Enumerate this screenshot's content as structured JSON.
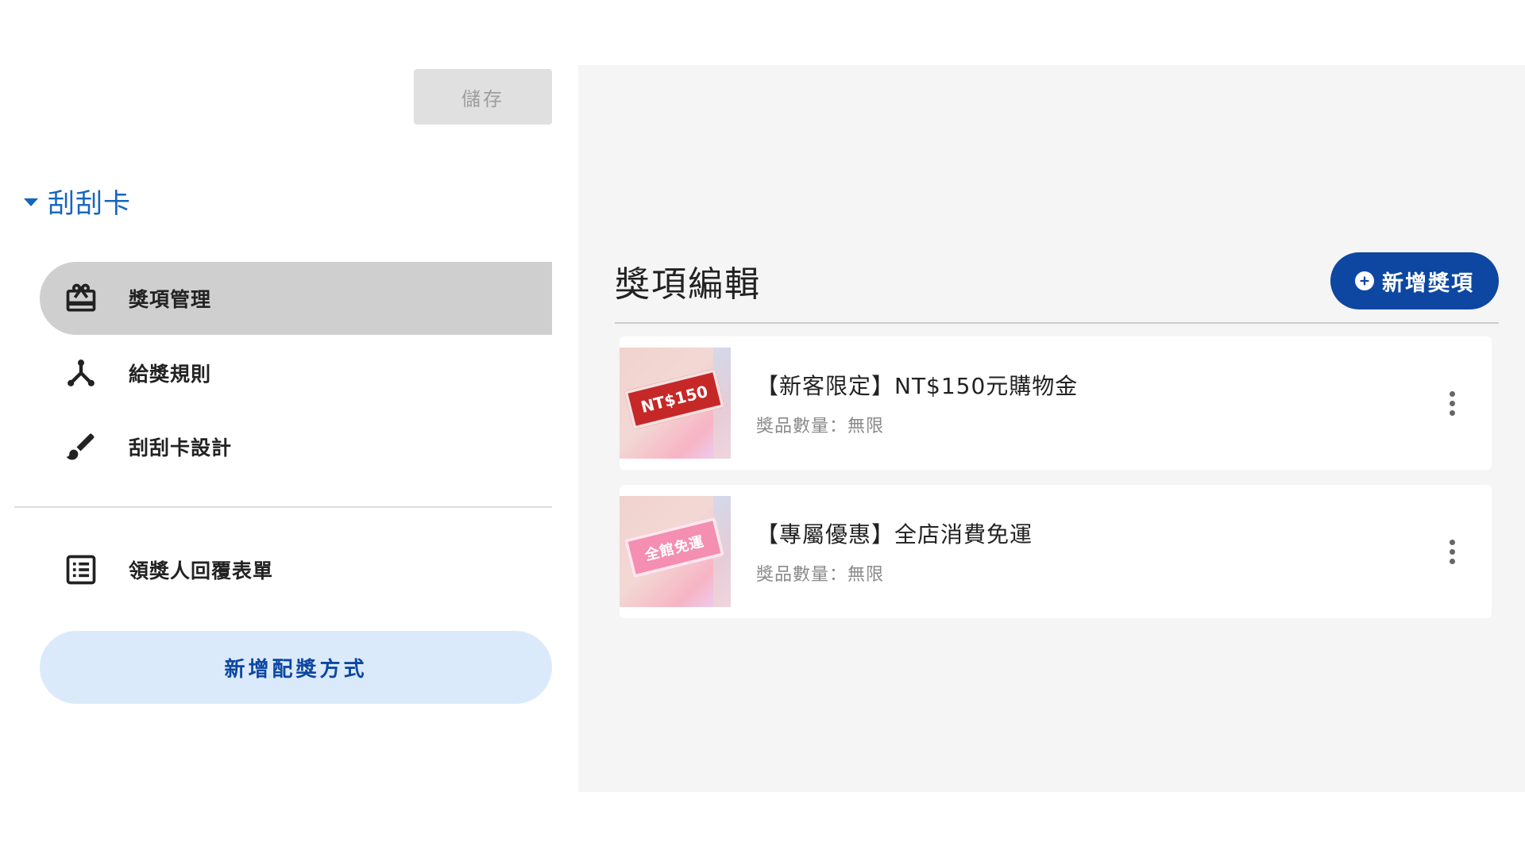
{
  "toolbar": {
    "save_label": "儲存"
  },
  "sidebar": {
    "section_title": "刮刮卡",
    "items": [
      {
        "label": "獎項管理",
        "icon": "gift-card-icon",
        "active": true
      },
      {
        "label": "給獎規則",
        "icon": "rule-split-icon",
        "active": false
      },
      {
        "label": "刮刮卡設計",
        "icon": "paint-brush-icon",
        "active": false
      },
      {
        "label": "領獎人回覆表單",
        "icon": "list-form-icon",
        "active": false
      }
    ],
    "add_method_label": "新增配獎方式"
  },
  "main": {
    "title": "獎項編輯",
    "add_prize_label": "新增獎項",
    "prizes": [
      {
        "name": "【新客限定】NT$150元購物金",
        "quantity": "獎品數量：無限",
        "thumb_text": "NT$150",
        "thumb_color": "#c62828"
      },
      {
        "name": "【專屬優惠】全店消費免運",
        "quantity": "獎品數量：無限",
        "thumb_text": "全館免運",
        "thumb_color": "#f48fb1"
      }
    ]
  },
  "colors": {
    "primary": "#0d47a1",
    "link": "#1565c0",
    "active_item_bg": "#cfcfcf",
    "add_method_bg": "#dbeafb",
    "panel_bg": "#f5f5f5"
  }
}
